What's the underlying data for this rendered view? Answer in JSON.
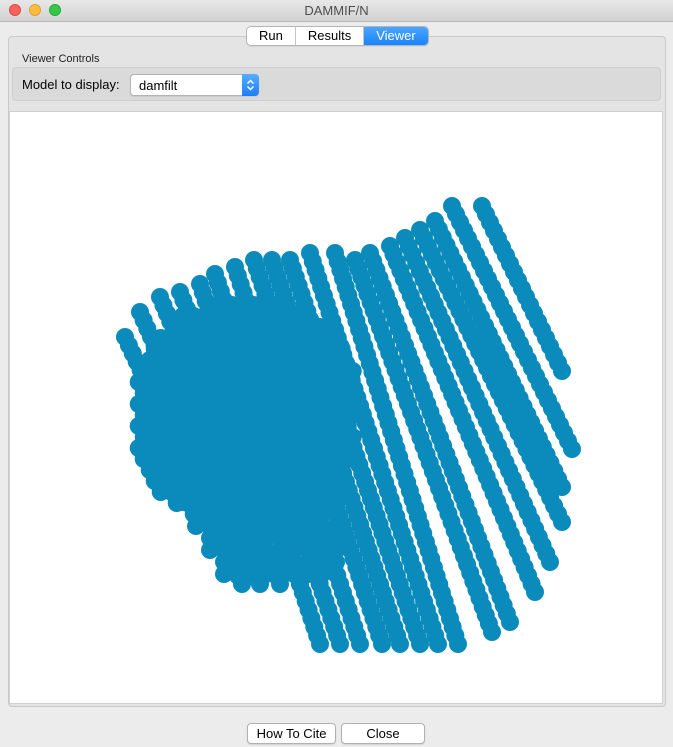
{
  "window": {
    "title": "DAMMIF/N"
  },
  "tabs": [
    {
      "label": "Run",
      "active": false
    },
    {
      "label": "Results",
      "active": false
    },
    {
      "label": "Viewer",
      "active": true
    }
  ],
  "viewer_controls": {
    "group_label": "Viewer Controls",
    "model_label": "Model to display:",
    "model_value": "damfilt"
  },
  "viewer": {
    "bead_color": "#0a8bbb"
  },
  "buttons": {
    "how_to_cite": "How To Cite",
    "close": "Close"
  },
  "colors": {
    "accent": "#1a82fb",
    "window_bg": "#ececec"
  }
}
